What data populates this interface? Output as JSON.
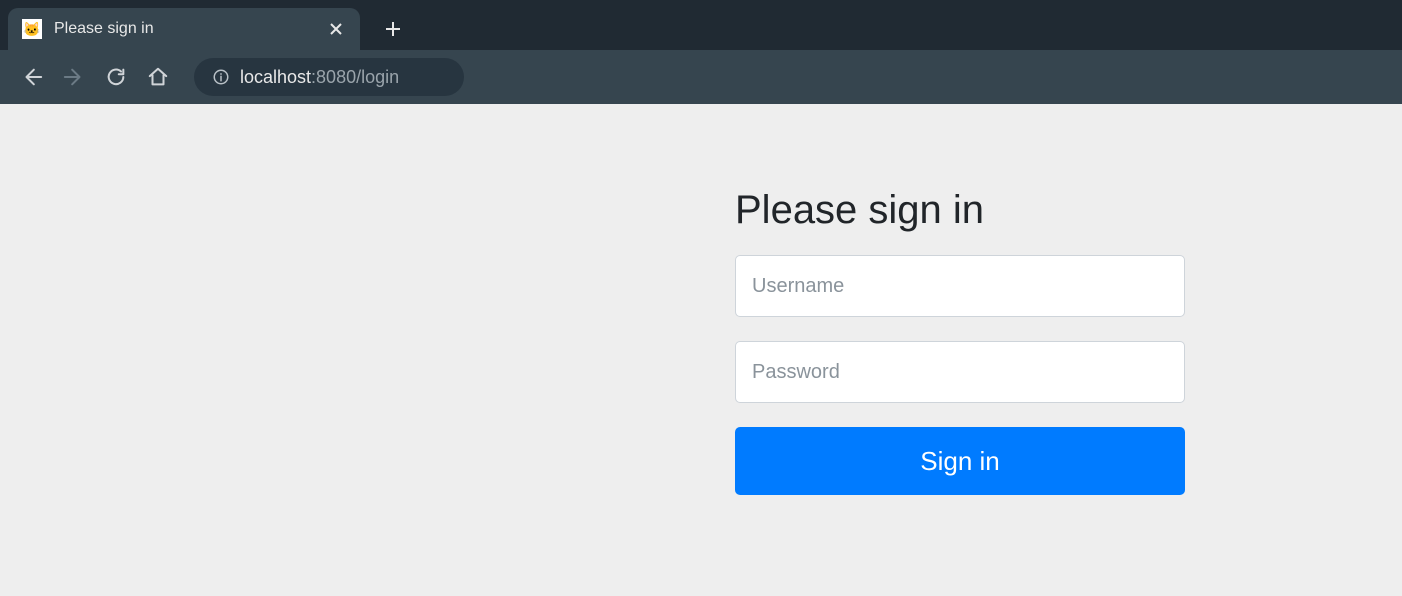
{
  "browser": {
    "tab_title": "Please sign in",
    "url_host": "localhost",
    "url_port": ":8080",
    "url_path": "/login"
  },
  "login": {
    "heading": "Please sign in",
    "username_placeholder": "Username",
    "password_placeholder": "Password",
    "submit_label": "Sign in"
  }
}
